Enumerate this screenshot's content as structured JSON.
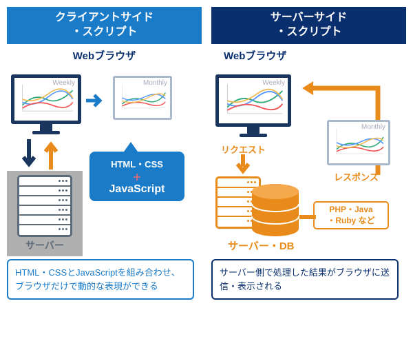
{
  "left": {
    "header": "クライアントサイド\n・スクリプト",
    "browser_label": "Webブラウザ",
    "chart1_title": "Weekly",
    "chart2_title": "Monthly",
    "callout_line1": "HTML・CSS",
    "callout_plus": "＋",
    "callout_line2": "JavaScript",
    "server_label": "サーバー",
    "desc": "HTML・CSSとJavaScriptを組み合わせ、ブラウザだけで動的な表現ができる"
  },
  "right": {
    "header": "サーバーサイド\n・スクリプト",
    "browser_label": "Webブラウザ",
    "chart1_title": "Weekly",
    "chart2_title": "Monthly",
    "request_label": "リクエスト",
    "response_label": "レスポンス",
    "server_label": "サーバー・DB",
    "tech_label": "PHP・Java\n・Ruby など",
    "desc": "サーバー側で処理した結果がブラウザに送信・表示される"
  }
}
